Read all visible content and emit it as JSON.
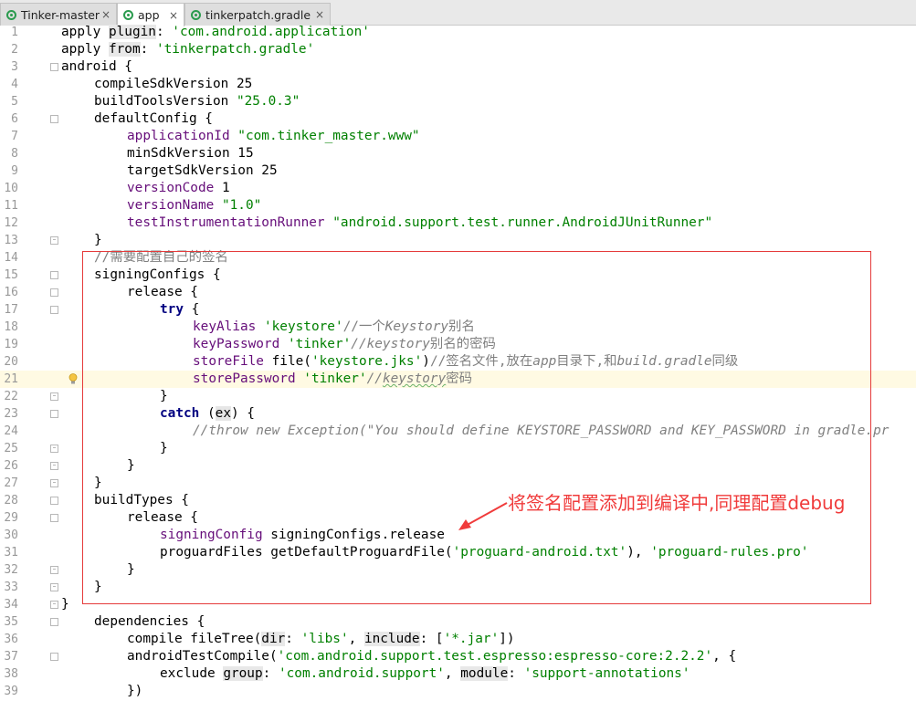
{
  "tabs": [
    {
      "label": "Tinker-master",
      "close": "×"
    },
    {
      "label": "app",
      "close": "×"
    },
    {
      "label": "tinkerpatch.gradle",
      "close": "×"
    }
  ],
  "annotation": "将签名配置添加到编译中,同理配置debug",
  "colors": {
    "annotation": "#f03b3b",
    "string": "#008000",
    "keyword": "#000080",
    "property": "#660e7a",
    "comment": "#808080"
  },
  "lines": [
    {
      "n": "1"
    },
    {
      "n": "2"
    },
    {
      "n": "3"
    },
    {
      "n": "4"
    },
    {
      "n": "5"
    },
    {
      "n": "6"
    },
    {
      "n": "7"
    },
    {
      "n": "8"
    },
    {
      "n": "9"
    },
    {
      "n": "10"
    },
    {
      "n": "11"
    },
    {
      "n": "12"
    },
    {
      "n": "13"
    },
    {
      "n": "14"
    },
    {
      "n": "15"
    },
    {
      "n": "16"
    },
    {
      "n": "17"
    },
    {
      "n": "18"
    },
    {
      "n": "19"
    },
    {
      "n": "20"
    },
    {
      "n": "21"
    },
    {
      "n": "22"
    },
    {
      "n": "23"
    },
    {
      "n": "24"
    },
    {
      "n": "25"
    },
    {
      "n": "26"
    },
    {
      "n": "27"
    },
    {
      "n": "28"
    },
    {
      "n": "29"
    },
    {
      "n": "30"
    },
    {
      "n": "31"
    },
    {
      "n": "32"
    },
    {
      "n": "33"
    },
    {
      "n": "34"
    },
    {
      "n": "35"
    },
    {
      "n": "36"
    },
    {
      "n": "37"
    },
    {
      "n": "38"
    },
    {
      "n": "39"
    }
  ],
  "code": {
    "l1": [
      "apply ",
      "plugin",
      ": ",
      "'com.android.application'"
    ],
    "l2": [
      "apply ",
      "from",
      ": ",
      "'tinkerpatch.gradle'"
    ],
    "l3": [
      "android {"
    ],
    "l4": [
      "compileSdkVersion 25"
    ],
    "l5": [
      "buildToolsVersion ",
      "\"25.0.3\""
    ],
    "l6": [
      "defaultConfig {"
    ],
    "l7": [
      "applicationId ",
      "\"com.tinker_master.www\""
    ],
    "l8": [
      "minSdkVersion 15"
    ],
    "l9": [
      "targetSdkVersion 25"
    ],
    "l10": [
      "versionCode ",
      "1"
    ],
    "l11": [
      "versionName ",
      "\"1.0\""
    ],
    "l12": [
      "testInstrumentationRunner ",
      "\"android.support.test.runner.AndroidJUnitRunner\""
    ],
    "l13": [
      "}"
    ],
    "l14": [
      "//需要配置自己的签名"
    ],
    "l15": [
      "signingConfigs {"
    ],
    "l16": [
      "release {"
    ],
    "l17": [
      "try",
      " {"
    ],
    "l18": [
      "keyAlias ",
      "'keystore'",
      "//一个",
      "Keystory",
      "别名"
    ],
    "l19": [
      "keyPassword ",
      "'tinker'",
      "//",
      "keystory",
      "别名的密码"
    ],
    "l20": [
      "storeFile ",
      "file(",
      "'keystore.jks'",
      ")",
      "//签名文件,放在",
      "app",
      "目录下,和",
      "build.gradle",
      "同级"
    ],
    "l21": [
      "storePassword ",
      "'tinker'",
      "//",
      "keystory",
      "密码"
    ],
    "l22": [
      "}"
    ],
    "l23": [
      "catch",
      " (",
      "ex",
      ") {"
    ],
    "l24": [
      "//throw new Exception(\"You should define KEYSTORE_PASSWORD and KEY_PASSWORD in gradle.pr"
    ],
    "l25": [
      "}"
    ],
    "l26": [
      "}"
    ],
    "l27": [
      "}"
    ],
    "l28": [
      "buildTypes {"
    ],
    "l29": [
      "release {"
    ],
    "l30": [
      "signingConfig ",
      "signingConfigs.release"
    ],
    "l31": [
      "proguardFiles getDefaultProguardFile(",
      "'proguard-android.txt'",
      "), ",
      "'proguard-rules.pro'"
    ],
    "l32": [
      "}"
    ],
    "l33": [
      "}"
    ],
    "l34": [
      "}"
    ],
    "l35": [
      "dependencies {"
    ],
    "l36": [
      "compile fileTree(",
      "dir",
      ": ",
      "'libs'",
      ", ",
      "include",
      ": [",
      "'*.jar'",
      "])"
    ],
    "l37": [
      "androidTestCompile(",
      "'com.android.support.test.espresso:espresso-core:2.2.2'",
      ", {"
    ],
    "l38": [
      "exclude ",
      "group",
      ": ",
      "'com.android.support'",
      ", ",
      "module",
      ": ",
      "'support-annotations'"
    ],
    "l39": [
      "})"
    ]
  }
}
